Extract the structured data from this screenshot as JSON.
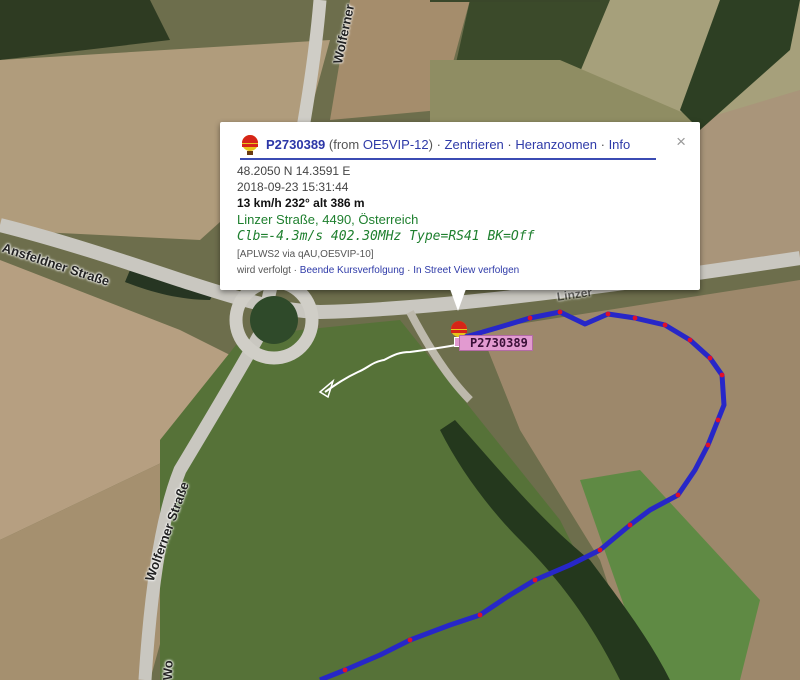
{
  "map": {
    "road_labels": {
      "ansfeldner": "Ansfeldner Straße",
      "wolfern_top": "Wolferner",
      "wolferner_left": "Wolferner Straße",
      "wolferner_bottom": "Wo",
      "linzer": "Linzer"
    },
    "track_color": "#2727c8",
    "track_dot_color": "#e0102a",
    "history_trail_color": "#ffffff"
  },
  "marker": {
    "icon": "hot-air-balloon-icon",
    "label": "P2730389"
  },
  "popup": {
    "callsign": "P2730389",
    "from_prefix": "(from ",
    "from_station": "OE5VIP-12",
    "from_suffix": ")",
    "sep": " · ",
    "action_center": "Zentrieren",
    "action_zoom": "Heranzoomen",
    "action_info": "Info",
    "close": "×",
    "position": "48.2050 N 14.3591 E",
    "timestamp": "2018-09-23 15:31:44",
    "motion": "13 km/h 232° alt 386 m",
    "address": "Linzer Straße, 4490, Österreich",
    "comment": "Clb=-4.3m/s 402.30MHz Type=RS41 BK=Off",
    "path": "[APLWS2 via qAU,OE5VIP-10]",
    "tracked_text": "wird verfolgt · ",
    "stop_tracking": "Beende Kursverfolgung",
    "streetview": "In Street View verfolgen"
  }
}
